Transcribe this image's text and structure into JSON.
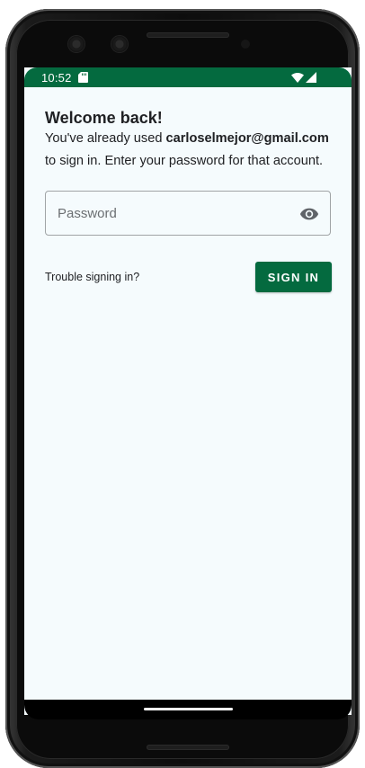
{
  "status_bar": {
    "time": "10:52",
    "icons": [
      "sd-card-icon",
      "wifi-icon",
      "signal-icon"
    ],
    "color": "#046a3f"
  },
  "main": {
    "title": "Welcome back!",
    "description_prefix": "You've already used ",
    "email": "carloselmejor@gmail.com",
    "description_suffix": "to sign in. Enter your password for that account.",
    "password": {
      "placeholder": "Password",
      "value": "",
      "toggle_icon": "eye-icon"
    },
    "trouble_link": "Trouble signing in?",
    "sign_in_label": "SIGN IN",
    "accent_color": "#046a3f"
  }
}
